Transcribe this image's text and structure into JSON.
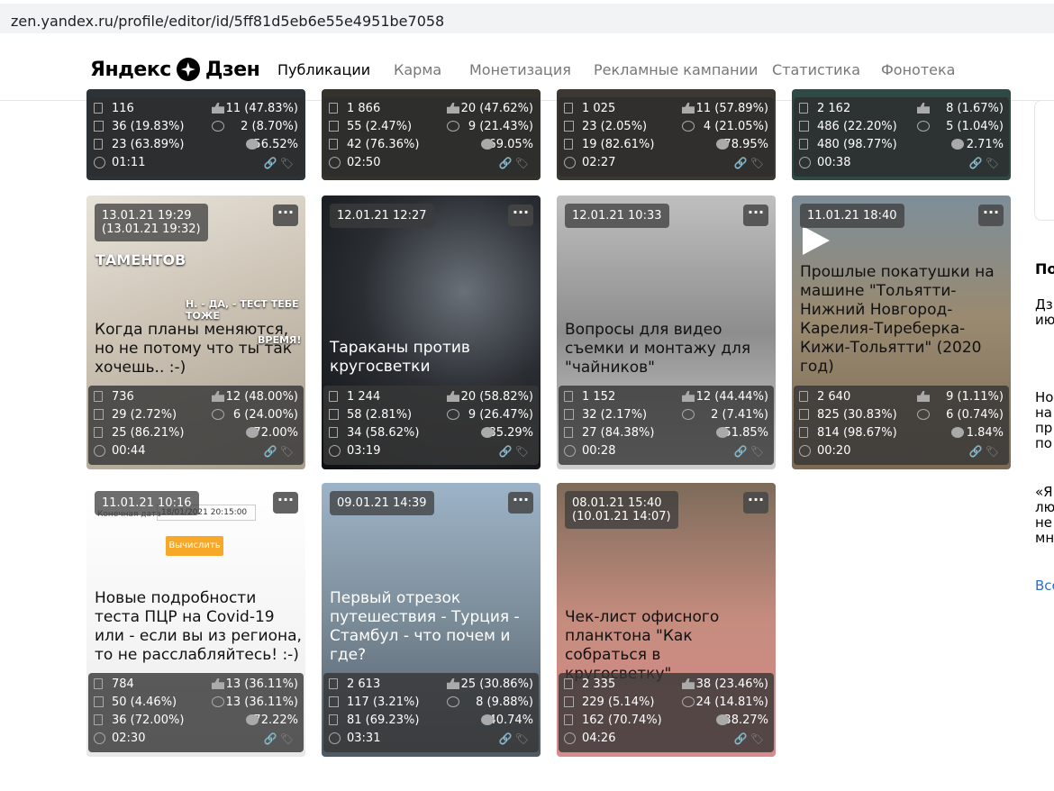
{
  "browser": {
    "url": "zen.yandex.ru/profile/editor/id/5ff81d5eb6e55e4951be7058"
  },
  "header": {
    "logo": "Яндекс",
    "logo_suffix": "Дзен",
    "nav": [
      "Публикации",
      "Карма",
      "Монетизация",
      "Рекламные кампании",
      "Статистика",
      "Фонотека"
    ],
    "active": "Публикации"
  },
  "top_cards": [
    {
      "s": [
        "116",
        "11 (47.83%)",
        "36 (19.83%)",
        "2 (8.70%)",
        "23 (63.89%)",
        "56.52%",
        "01:11"
      ]
    },
    {
      "s": [
        "1 866",
        "20 (47.62%)",
        "55 (2.47%)",
        "9 (21.43%)",
        "42 (76.36%)",
        "69.05%",
        "02:50"
      ]
    },
    {
      "s": [
        "1 025",
        "11 (57.89%)",
        "23 (2.05%)",
        "4 (21.05%)",
        "19 (82.61%)",
        "78.95%",
        "02:27"
      ]
    },
    {
      "s": [
        "2 162",
        "8 (1.67%)",
        "486 (22.20%)",
        "5 (1.04%)",
        "480 (98.77%)",
        "2.71%",
        "00:38"
      ]
    }
  ],
  "cards": [
    {
      "date": "13.01.21 19:29",
      "date2": "(13.01.21 19:32)",
      "title": "Когда планы меняются, но не потому что ты так хочешь.. :-)",
      "s": [
        "736",
        "12 (48.00%)",
        "29 (2.72%)",
        "6 (24.00%)",
        "25 (86.21%)",
        "72.00%",
        "00:44"
      ]
    },
    {
      "date": "12.01.21 12:27",
      "date2": "",
      "title": "Тараканы против кругосветки",
      "s": [
        "1 244",
        "20 (58.82%)",
        "58 (2.81%)",
        "9 (26.47%)",
        "34 (58.62%)",
        "85.29%",
        "03:19"
      ]
    },
    {
      "date": "12.01.21 10:33",
      "date2": "",
      "title": "Вопросы для видео съемки и монтажу для \"чайников\"",
      "s": [
        "1 152",
        "12 (44.44%)",
        "32 (2.17%)",
        "2 (7.41%)",
        "27 (84.38%)",
        "51.85%",
        "00:28"
      ]
    },
    {
      "date": "11.01.21 18:40",
      "date2": "",
      "title": "Прошлые покатушки на машине \"Тольятти-Нижний Новгород-Карелия-Тиреберка-Кижи-Тольятти\" (2020 год)",
      "s": [
        "2 640",
        "9 (1.11%)",
        "825 (30.83%)",
        "6 (0.74%)",
        "814 (98.67%)",
        "1.84%",
        "00:20"
      ]
    },
    {
      "date": "11.01.21 10:16",
      "date2": "",
      "title": "Новые подробности теста ПЦР на Covid-19 или - если вы из региона, то не расслабляйтесь! :-)",
      "s": [
        "784",
        "13 (36.11%)",
        "50 (4.46%)",
        "13 (36.11%)",
        "36 (72.00%)",
        "72.22%",
        "02:30"
      ]
    },
    {
      "date": "09.01.21 14:39",
      "date2": "",
      "title": "Первый отрезок путешествия - Турция - Стамбул - что почем и где?",
      "s": [
        "2 613",
        "25 (30.86%)",
        "117 (3.21%)",
        "8 (9.88%)",
        "81 (69.23%)",
        "40.74%",
        "03:31"
      ]
    },
    {
      "date": "08.01.21 15:40",
      "date2": "(10.01.21 14:07)",
      "title": "Чек-лист офисного планктона \"Как собраться в кругосветку\"",
      "s": [
        "2 335",
        "38 (23.46%)",
        "229 (5.14%)",
        "24 (14.81%)",
        "162 (70.74%)",
        "38.27%",
        "04:26"
      ]
    }
  ],
  "thumb_text": {
    "calc_button": "Вычислить",
    "end_date_label": "Конечная дата",
    "end_date": "18/01/2021 20:15:00",
    "cat_line1": "ТАМЕНТОВ",
    "cat_line2": "Н. - ДА, - ТЕСТ ТЕБЕ ТОЖЕ",
    "cat_line3": "ВРЕМЯ!"
  },
  "right": {
    "heading": "По",
    "t1a": "Дз",
    "t1b": "ию",
    "t2a": "Но",
    "t2b": "на",
    "t2c": "пр",
    "t2d": "по",
    "t3a": "«Я",
    "t3b": "лю",
    "t3c": "не",
    "t3d": "мн",
    "link": "Все"
  }
}
